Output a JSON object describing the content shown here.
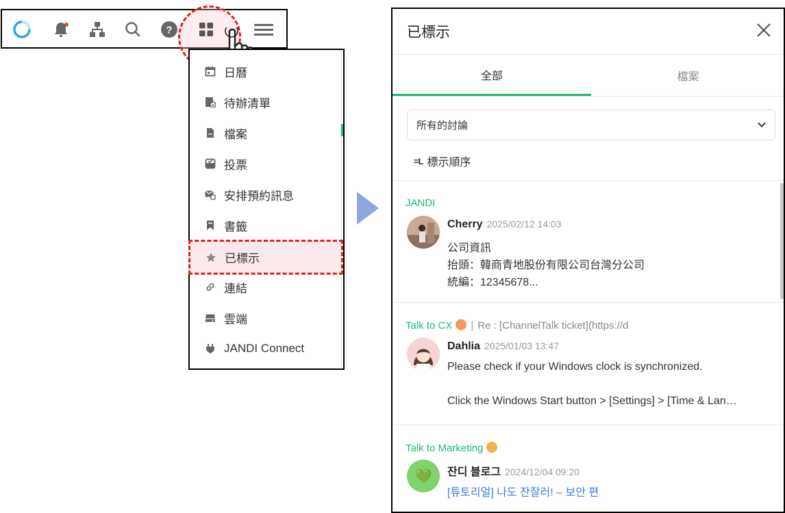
{
  "toolbar": {
    "icons": [
      "loading-ring-icon",
      "bell-icon",
      "org-chart-icon",
      "search-icon",
      "help-icon",
      "grid-icon",
      "cursor-hand-icon",
      "menu-icon"
    ],
    "help_glyph": "?"
  },
  "menu": {
    "items": [
      {
        "icon": "calendar-icon",
        "label": "日曆"
      },
      {
        "icon": "todo-icon",
        "label": "待辦清單"
      },
      {
        "icon": "file-icon",
        "label": "檔案"
      },
      {
        "icon": "vote-icon",
        "label": "投票"
      },
      {
        "icon": "scheduled-message-icon",
        "label": "安排預約訊息"
      },
      {
        "icon": "bookmark-icon",
        "label": "書籤"
      },
      {
        "icon": "star-icon",
        "label": "已標示"
      },
      {
        "icon": "link-icon",
        "label": "連結"
      },
      {
        "icon": "cloud-drive-icon",
        "label": "雲端"
      },
      {
        "icon": "plug-icon",
        "label": "JANDI Connect"
      }
    ]
  },
  "panel": {
    "title": "已標示",
    "tabs": [
      {
        "label": "全部"
      },
      {
        "label": "檔案"
      }
    ],
    "filter": {
      "selected": "所有的討論"
    },
    "sort_icon": "=L",
    "sort_label": "標示順序",
    "messages": [
      {
        "channel": "JANDI",
        "author": "Cherry",
        "time": "2025/02/12 14:03",
        "lines": [
          "公司資訊",
          "抬頭：韓商青地股份有限公司台灣分公司",
          "統編：12345678..."
        ]
      },
      {
        "channel": "Talk to CX",
        "separator": "|",
        "thread": "Re : [ChannelTalk ticket](https://d",
        "author": "Dahlia",
        "time": "2025/01/03 13:47",
        "lines": [
          "Please check if your Windows clock is synchronized.",
          "Click the Windows Start button > [Settings] > [Time & Lan…"
        ]
      },
      {
        "channel": "Talk to Marketing",
        "author": "잔디 블로그",
        "time": "2024/12/04 09:20",
        "lines": [
          "[튜토리얼] 나도 잔잘러! – 보안 편"
        ],
        "avatar_glyph": "💚"
      }
    ]
  },
  "colors": {
    "accent": "#1fb774",
    "highlight": "#e02020",
    "link": "#3b7ddd",
    "arrow": "#8ea7dd"
  }
}
